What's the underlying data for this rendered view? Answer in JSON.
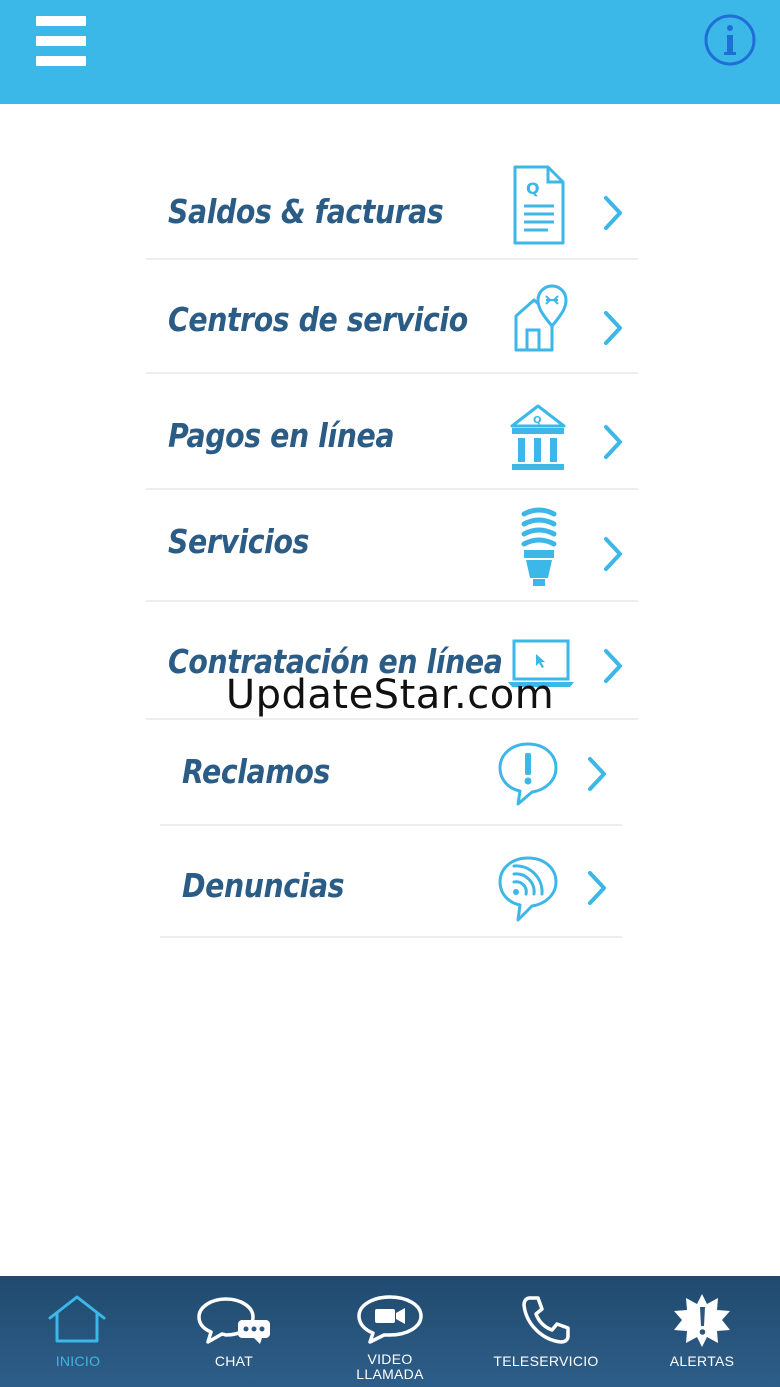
{
  "header": {
    "menu_icon": "hamburger-icon",
    "info_icon": "info-icon",
    "color": "#3bb7e8"
  },
  "menu": {
    "items": [
      {
        "label": "Saldos & facturas",
        "icon": "invoice-document-icon"
      },
      {
        "label": "Centros de servicio",
        "icon": "service-center-location-icon"
      },
      {
        "label": "Pagos en línea",
        "icon": "bank-icon"
      },
      {
        "label": "Servicios",
        "icon": "light-bulb-icon"
      },
      {
        "label": "Contratación en línea",
        "icon": "laptop-icon"
      },
      {
        "label": "Reclamos",
        "icon": "exclamation-speech-bubble-icon"
      },
      {
        "label": "Denuncias",
        "icon": "signal-speech-bubble-icon"
      }
    ],
    "label_color": "#2b5c86",
    "icon_color": "#3bb7e8"
  },
  "watermark": "UpdateStar.com",
  "tabbar": {
    "tabs": [
      {
        "label": "INICIO",
        "icon": "home-icon",
        "active": true
      },
      {
        "label": "CHAT",
        "icon": "chat-icon",
        "active": false
      },
      {
        "label": "VIDEO\nLLAMADA",
        "line1": "VIDEO",
        "line2": "LLAMADA",
        "icon": "video-call-icon",
        "active": false
      },
      {
        "label": "TELESERVICIO",
        "icon": "phone-icon",
        "active": false
      },
      {
        "label": "ALERTAS",
        "icon": "alert-icon",
        "active": false
      }
    ],
    "active_color": "#3bb7e8"
  }
}
